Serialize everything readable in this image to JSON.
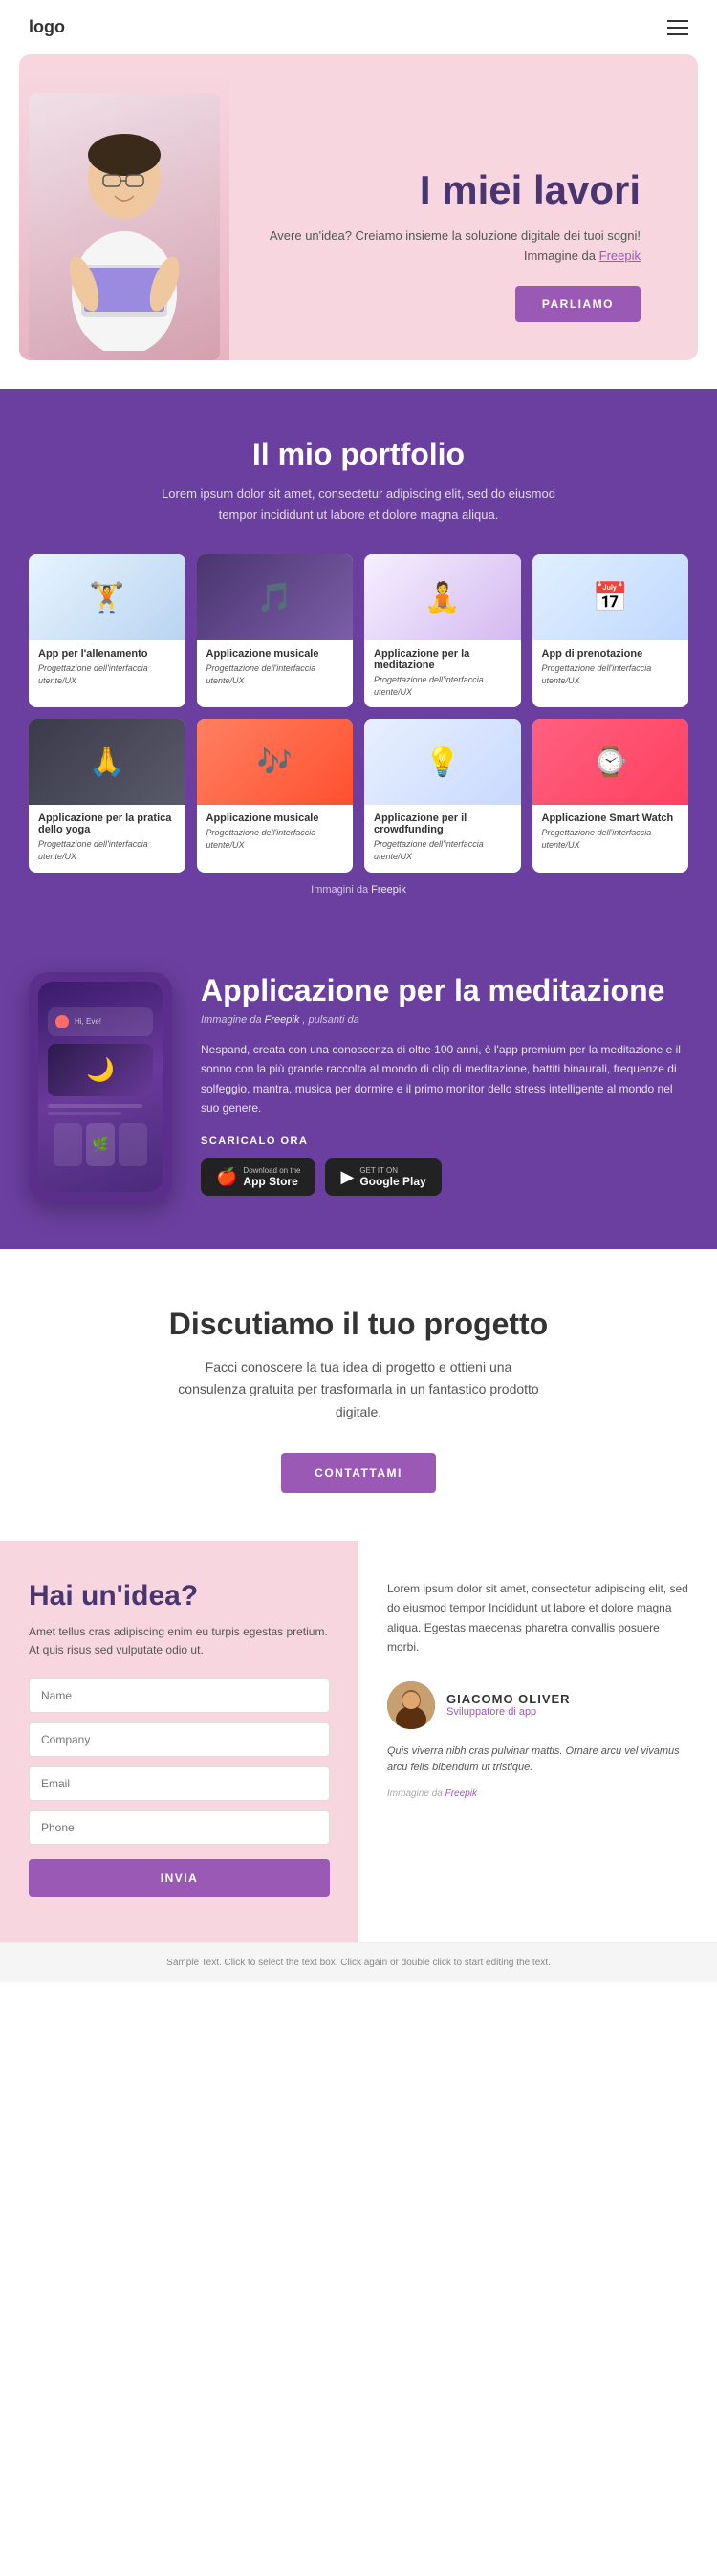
{
  "nav": {
    "logo": "logo",
    "menu_icon": "☰"
  },
  "hero": {
    "title": "I miei lavori",
    "subtitle": "Avere un'idea? Creiamo insieme la soluzione digitale dei tuoi sogni! Immagine da",
    "freepik_link": "Freepik",
    "cta_label": "PARLIAMO",
    "person_emoji": "👨‍💻"
  },
  "portfolio": {
    "title": "Il mio portfolio",
    "subtitle": "Lorem ipsum dolor sit amet, consectetur adipiscing elit, sed do eiusmod tempor incididunt ut labore et dolore magna aliqua.",
    "cards": [
      {
        "id": "fitness",
        "title": "App per l'allenamento",
        "category": "Progettazione dell'interfaccia utente/UX",
        "emoji": "🏋️",
        "bg": "fitness"
      },
      {
        "id": "music1",
        "title": "Applicazione musicale",
        "category": "Progettazione dell'interfaccia utente/UX",
        "emoji": "🎵",
        "bg": "music1"
      },
      {
        "id": "meditation",
        "title": "Applicazione per la meditazione",
        "category": "Progettazione dell'interfaccia utente/UX",
        "emoji": "🧘",
        "bg": "meditation"
      },
      {
        "id": "booking",
        "title": "App di prenotazione",
        "category": "Progettazione dell'interfaccia utente/UX",
        "emoji": "📅",
        "bg": "booking"
      },
      {
        "id": "yoga",
        "title": "Applicazione per la pratica dello yoga",
        "category": "Progettazione dell'interfaccia utente/UX",
        "emoji": "🙏",
        "bg": "yoga"
      },
      {
        "id": "music2",
        "title": "Applicazione musicale",
        "category": "Progettazione dell'interfaccia utente/UX",
        "emoji": "🎶",
        "bg": "music2"
      },
      {
        "id": "crowdfund",
        "title": "Applicazione per il crowdfunding",
        "category": "Progettazione dell'interfaccia utente/UX",
        "emoji": "💡",
        "bg": "crowdfund"
      },
      {
        "id": "smartwatch",
        "title": "Applicazione Smart Watch",
        "category": "Progettazione dell'interfaccia utente/UX",
        "emoji": "⌚",
        "bg": "smartwatch"
      }
    ],
    "freepik_note": "Immagini da",
    "freepik_link": "Freepik"
  },
  "app_detail": {
    "title": "Applicazione per la meditazione",
    "from_label": "Immagine da",
    "from_link": "Freepik",
    "from_suffix": ", pulsanti da",
    "description": "Nespand, creata con una conoscenza di oltre 100 anni, è l'app premium per la meditazione e il sonno con la più grande raccolta al mondo di clip di meditazione, battiti binaurali, frequenze di solfeggio, mantra, musica per dormire e il primo monitor dello stress intelligente al mondo nel suo genere.",
    "scarica_label": "SCARICALO ORA",
    "app_store_small": "Download on the",
    "app_store_big": "App Store",
    "google_play_small": "GET IT ON",
    "google_play_big": "Google Play",
    "mockup_emoji": "🌙"
  },
  "contact": {
    "title": "Discutiamo il tuo progetto",
    "subtitle": "Facci conoscere la tua idea di progetto e ottieni una consulenza gratuita per trasformarla in un fantastico prodotto digitale.",
    "cta_label": "CONTATTAMI"
  },
  "bottom": {
    "left": {
      "title": "Hai un'idea?",
      "subtitle": "Amet tellus cras adipiscing enim eu turpis egestas pretium. At quis risus sed vulputate odio ut.",
      "name_placeholder": "Name",
      "company_placeholder": "Company",
      "email_placeholder": "Email",
      "phone_placeholder": "Phone",
      "submit_label": "INVIA"
    },
    "right": {
      "testimonial": "Lorem ipsum dolor sit amet, consectetur adipiscing elit, sed do eiusmod tempor Incididunt ut labore et dolore magna aliqua. Egestas maecenas pharetra convallis posuere morbi.",
      "author_name": "GIACOMO OLIVER",
      "author_role": "Sviluppatore di app",
      "author_emoji": "👨",
      "quote": "Quis viverra nibh cras pulvinar mattis. Ornare arcu vel vivamus arcu felis bibendum ut tristique.",
      "img_credit": "Immagine da",
      "img_link": "Freepik"
    }
  },
  "footer": {
    "text": "Sample Text. Click to select the text box. Click again or double click to start editing the text."
  }
}
